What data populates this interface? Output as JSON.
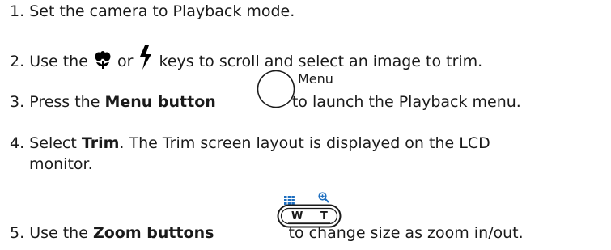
{
  "steps": [
    {
      "num": "1.",
      "text": "Set the camera to Playback mode."
    },
    {
      "num": "2.",
      "pre": "Use the ",
      "mid": " or ",
      "post": " keys to scroll and select an image to trim."
    },
    {
      "num": "3.",
      "pre": "Press the ",
      "bold": "Menu button",
      "post": " to launch the Playback menu.",
      "icon_label": "Menu"
    },
    {
      "num": "4.",
      "pre": "Select ",
      "bold": "Trim",
      "post": ". The Trim screen layout is displayed on the LCD",
      "line2": "monitor."
    },
    {
      "num": "5.",
      "pre": "Use the ",
      "bold": "Zoom buttons",
      "post": " to change size as zoom in/out.",
      "zoom_w": "W",
      "zoom_t": "T"
    }
  ],
  "icons": {
    "macro": "macro-flower-icon",
    "flash": "flash-bolt-icon",
    "menu": "menu-circle-button-icon",
    "thumbnail": "thumbnail-grid-icon",
    "magnify": "magnify-plus-icon",
    "zoom_rocker": "zoom-rocker-icon"
  },
  "colors": {
    "text": "#1a1a1a",
    "icon_blue": "#1e6fc0"
  }
}
